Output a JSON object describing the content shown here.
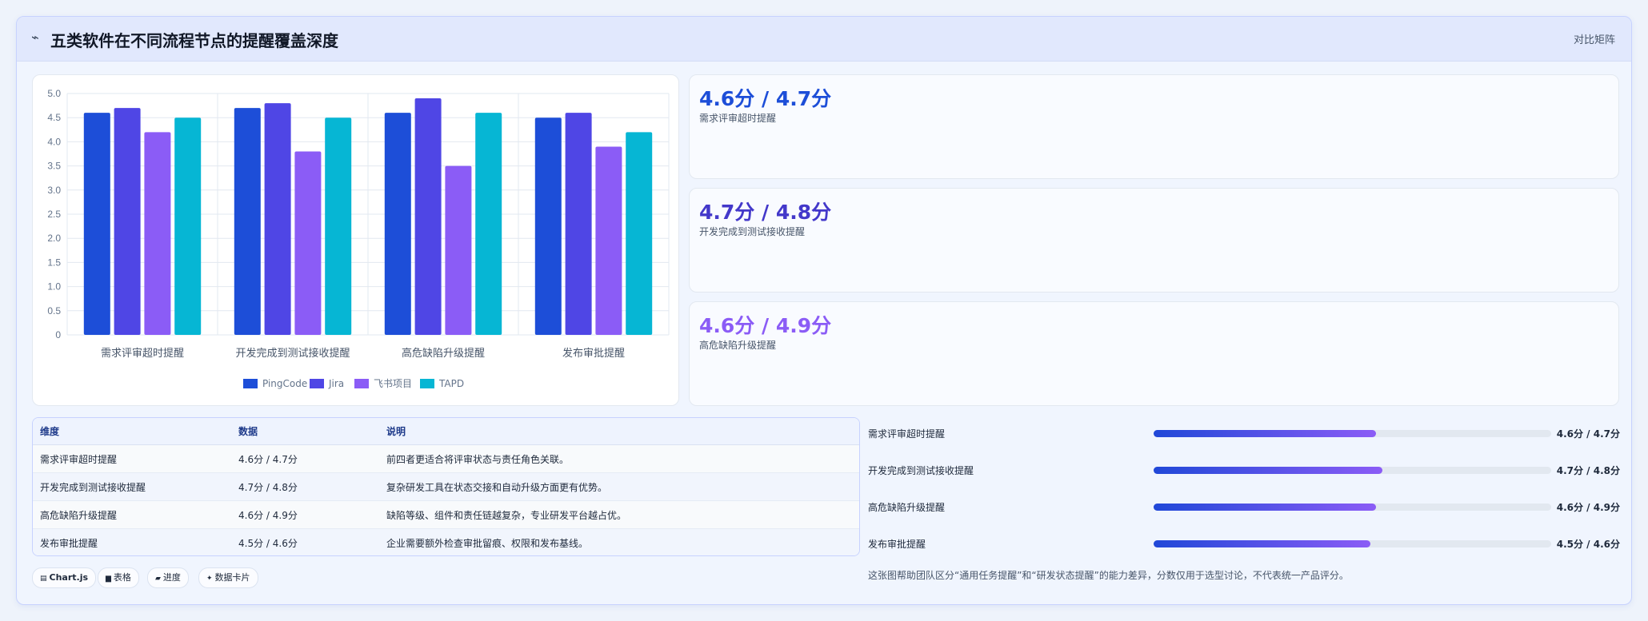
{
  "header": {
    "icon": "trend-icon",
    "title": "五类软件在不同流程节点的提醒覆盖深度",
    "right_label": "对比矩阵"
  },
  "chart_data": {
    "type": "bar",
    "categories": [
      "需求评审超时提醒",
      "开发完成到测试接收提醒",
      "高危缺陷升级提醒",
      "发布审批提醒"
    ],
    "series": [
      {
        "name": "PingCode",
        "color": "#1d4ed8",
        "values": [
          4.6,
          4.7,
          4.6,
          4.5
        ]
      },
      {
        "name": "Jira",
        "color": "#4f46e5",
        "values": [
          4.7,
          4.8,
          4.9,
          4.6
        ]
      },
      {
        "name": "飞书项目",
        "color": "#8b5cf6",
        "values": [
          4.2,
          3.8,
          3.5,
          3.9
        ]
      },
      {
        "name": "TAPD",
        "color": "#06b6d4",
        "values": [
          4.5,
          4.5,
          4.6,
          4.2
        ]
      }
    ],
    "ylim": [
      0,
      5
    ],
    "yticks": [
      "0",
      "0.5",
      "1.0",
      "1.5",
      "2.0",
      "2.5",
      "3.0",
      "3.5",
      "4.0",
      "4.5",
      "5.0"
    ],
    "grid": true,
    "legend": "bottom"
  },
  "kpis": [
    {
      "value": "4.6分 / 4.7分",
      "label": "需求评审超时提醒",
      "color": "#1d4ed8"
    },
    {
      "value": "4.7分 / 4.8分",
      "label": "开发完成到测试接收提醒",
      "color": "#4338ca"
    },
    {
      "value": "4.6分 / 4.9分",
      "label": "高危缺陷升级提醒",
      "color": "#8b5cf6"
    }
  ],
  "table": {
    "headers": [
      "维度",
      "数据",
      "说明"
    ],
    "rows": [
      [
        "需求评审超时提醒",
        "4.6分 / 4.7分",
        "前四者更适合将评审状态与责任角色关联。"
      ],
      [
        "开发完成到测试接收提醒",
        "4.7分 / 4.8分",
        "复杂研发工具在状态交接和自动升级方面更有优势。"
      ],
      [
        "高危缺陷升级提醒",
        "4.6分 / 4.9分",
        "缺陷等级、组件和责任链越复杂，专业研发平台越占优。"
      ],
      [
        "发布审批提醒",
        "4.5分 / 4.6分",
        "企业需要额外检查审批留痕、权限和发布基线。"
      ]
    ]
  },
  "progress": [
    {
      "label": "需求评审超时提醒",
      "value": "4.6分 / 4.7分",
      "fill": 0.56
    },
    {
      "label": "开发完成到测试接收提醒",
      "value": "4.7分 / 4.8分",
      "fill": 0.575
    },
    {
      "label": "高危缺陷升级提醒",
      "value": "4.6分 / 4.9分",
      "fill": 0.56
    },
    {
      "label": "发布审批提醒",
      "value": "4.5分 / 4.6分",
      "fill": 0.545
    }
  ],
  "note": "这张图帮助团队区分“通用任务提醒”和“研发状态提醒”的能力差异，分数仅用于选型讨论，不代表统一产品评分。",
  "chips": [
    {
      "icon": "chart-icon",
      "glyph": "▤",
      "label": "Chart.js",
      "bold": true
    },
    {
      "icon": "table-icon",
      "glyph": "▆",
      "label": "表格"
    },
    {
      "icon": "progress-icon",
      "glyph": "▰",
      "label": "进度"
    },
    {
      "icon": "sparkle-icon",
      "glyph": "✦",
      "label": "数据卡片"
    }
  ]
}
